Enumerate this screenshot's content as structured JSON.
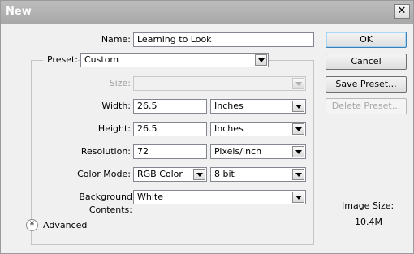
{
  "window": {
    "title": "New",
    "close_glyph": "✕"
  },
  "form": {
    "name": {
      "label": "Name:",
      "value": "Learning to Look"
    },
    "preset": {
      "label": "Preset:",
      "value": "Custom"
    },
    "size": {
      "label": "Size:",
      "value": ""
    },
    "width": {
      "label": "Width:",
      "value": "26.5",
      "unit": "Inches"
    },
    "height": {
      "label": "Height:",
      "value": "26.5",
      "unit": "Inches"
    },
    "resolution": {
      "label": "Resolution:",
      "value": "72",
      "unit": "Pixels/Inch"
    },
    "color_mode": {
      "label": "Color Mode:",
      "mode": "RGB Color",
      "depth": "8 bit"
    },
    "background": {
      "label": "Background Contents:",
      "value": "White"
    },
    "advanced": {
      "label": "Advanced",
      "icon_glyph": "¥"
    }
  },
  "buttons": {
    "ok": "OK",
    "cancel": "Cancel",
    "save_preset": "Save Preset...",
    "delete_preset": "Delete Preset..."
  },
  "image_size": {
    "label": "Image Size:",
    "value": "10.4M"
  },
  "colors": {
    "titlebar": "#a8a8a8",
    "dialog_bg": "#f0f0f0",
    "default_button_border": "#3c7fb1"
  }
}
